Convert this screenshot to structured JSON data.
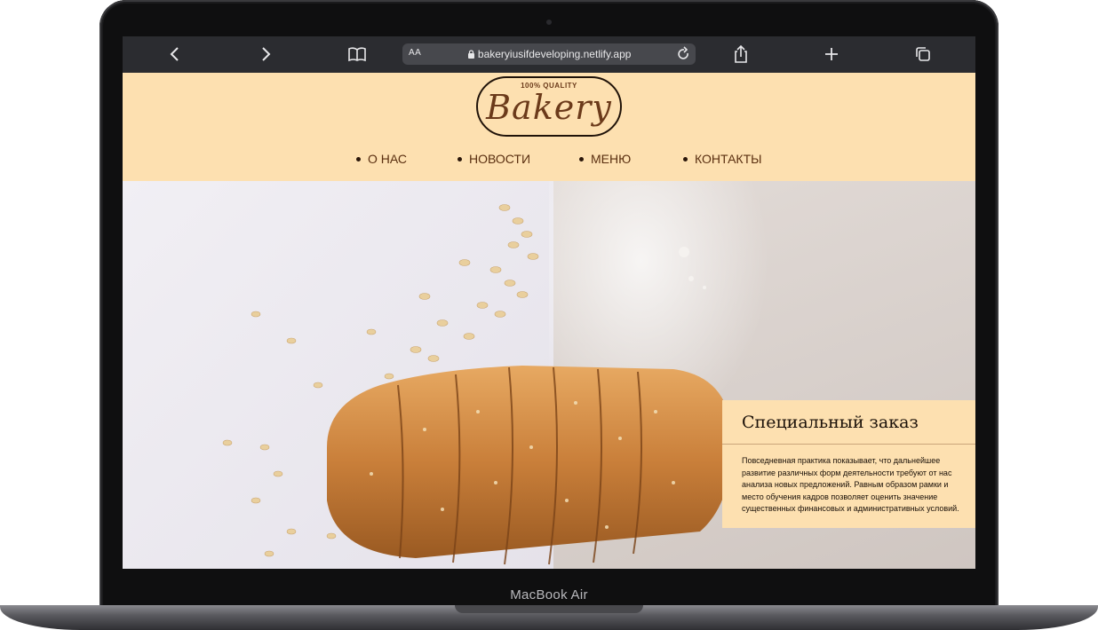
{
  "device": {
    "label": "MacBook Air"
  },
  "browser": {
    "text_size_label": "AA",
    "url": "bakeryiusifdeveloping.netlify.app",
    "icons": [
      "back-icon",
      "forward-icon",
      "book-icon",
      "lock-icon",
      "reload-icon",
      "share-icon",
      "plus-icon",
      "tabs-icon"
    ]
  },
  "site": {
    "logo": {
      "tagline": "100% QUALITY",
      "word": "Bakery"
    },
    "nav": [
      {
        "label": "О НАС"
      },
      {
        "label": "НОВОСТИ"
      },
      {
        "label": "МЕНЮ"
      },
      {
        "label": "КОНТАКТЫ"
      }
    ],
    "promo": {
      "title": "Специальный заказ",
      "text": "Повседневная практика показывает, что дальнейшее развитие различных форм деятельности требуют от нас анализа новых предложений. Равным образом рамки и место обучения кадров позволяет оценить значение существенных финансовых и административных условий."
    }
  },
  "colors": {
    "header_bg": "#fde0b0",
    "brand_brown": "#6b3a1a",
    "browser_bar": "#2b2c30"
  }
}
